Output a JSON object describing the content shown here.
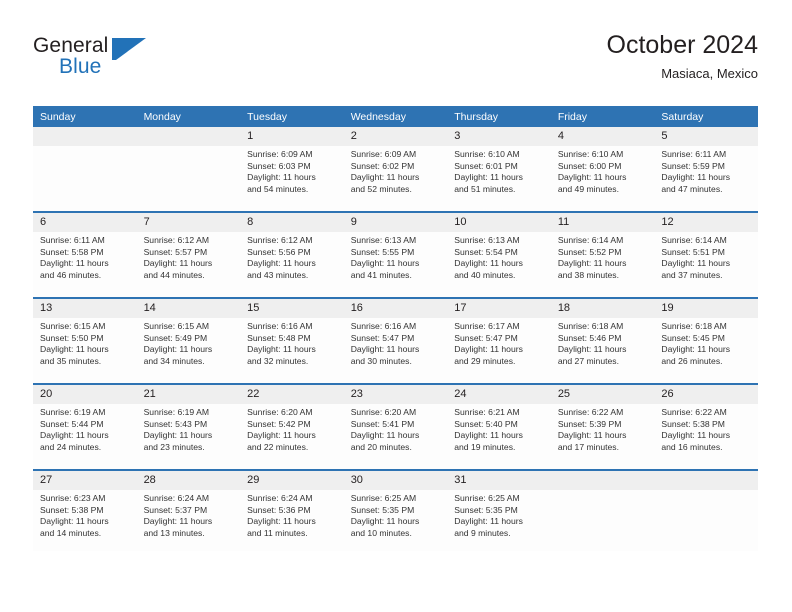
{
  "brand": {
    "name_top": "General",
    "name_bottom": "Blue",
    "logo_icon": "flag-triangle-icon",
    "accent_color": "#2272b8"
  },
  "header": {
    "title": "October 2024",
    "subtitle": "Masiaca, Mexico"
  },
  "theme": {
    "header_blue": "#2e73b3",
    "daynum_gray": "#efefef",
    "cell_white": "#fdfdfd"
  },
  "weekdays": [
    "Sunday",
    "Monday",
    "Tuesday",
    "Wednesday",
    "Thursday",
    "Friday",
    "Saturday"
  ],
  "weeks": [
    {
      "days": [
        {
          "num": "",
          "sunrise": "",
          "sunset": "",
          "daylight_1": "",
          "daylight_2": ""
        },
        {
          "num": "",
          "sunrise": "",
          "sunset": "",
          "daylight_1": "",
          "daylight_2": ""
        },
        {
          "num": "1",
          "sunrise": "Sunrise: 6:09 AM",
          "sunset": "Sunset: 6:03 PM",
          "daylight_1": "Daylight: 11 hours",
          "daylight_2": "and 54 minutes."
        },
        {
          "num": "2",
          "sunrise": "Sunrise: 6:09 AM",
          "sunset": "Sunset: 6:02 PM",
          "daylight_1": "Daylight: 11 hours",
          "daylight_2": "and 52 minutes."
        },
        {
          "num": "3",
          "sunrise": "Sunrise: 6:10 AM",
          "sunset": "Sunset: 6:01 PM",
          "daylight_1": "Daylight: 11 hours",
          "daylight_2": "and 51 minutes."
        },
        {
          "num": "4",
          "sunrise": "Sunrise: 6:10 AM",
          "sunset": "Sunset: 6:00 PM",
          "daylight_1": "Daylight: 11 hours",
          "daylight_2": "and 49 minutes."
        },
        {
          "num": "5",
          "sunrise": "Sunrise: 6:11 AM",
          "sunset": "Sunset: 5:59 PM",
          "daylight_1": "Daylight: 11 hours",
          "daylight_2": "and 47 minutes."
        }
      ]
    },
    {
      "days": [
        {
          "num": "6",
          "sunrise": "Sunrise: 6:11 AM",
          "sunset": "Sunset: 5:58 PM",
          "daylight_1": "Daylight: 11 hours",
          "daylight_2": "and 46 minutes."
        },
        {
          "num": "7",
          "sunrise": "Sunrise: 6:12 AM",
          "sunset": "Sunset: 5:57 PM",
          "daylight_1": "Daylight: 11 hours",
          "daylight_2": "and 44 minutes."
        },
        {
          "num": "8",
          "sunrise": "Sunrise: 6:12 AM",
          "sunset": "Sunset: 5:56 PM",
          "daylight_1": "Daylight: 11 hours",
          "daylight_2": "and 43 minutes."
        },
        {
          "num": "9",
          "sunrise": "Sunrise: 6:13 AM",
          "sunset": "Sunset: 5:55 PM",
          "daylight_1": "Daylight: 11 hours",
          "daylight_2": "and 41 minutes."
        },
        {
          "num": "10",
          "sunrise": "Sunrise: 6:13 AM",
          "sunset": "Sunset: 5:54 PM",
          "daylight_1": "Daylight: 11 hours",
          "daylight_2": "and 40 minutes."
        },
        {
          "num": "11",
          "sunrise": "Sunrise: 6:14 AM",
          "sunset": "Sunset: 5:52 PM",
          "daylight_1": "Daylight: 11 hours",
          "daylight_2": "and 38 minutes."
        },
        {
          "num": "12",
          "sunrise": "Sunrise: 6:14 AM",
          "sunset": "Sunset: 5:51 PM",
          "daylight_1": "Daylight: 11 hours",
          "daylight_2": "and 37 minutes."
        }
      ]
    },
    {
      "days": [
        {
          "num": "13",
          "sunrise": "Sunrise: 6:15 AM",
          "sunset": "Sunset: 5:50 PM",
          "daylight_1": "Daylight: 11 hours",
          "daylight_2": "and 35 minutes."
        },
        {
          "num": "14",
          "sunrise": "Sunrise: 6:15 AM",
          "sunset": "Sunset: 5:49 PM",
          "daylight_1": "Daylight: 11 hours",
          "daylight_2": "and 34 minutes."
        },
        {
          "num": "15",
          "sunrise": "Sunrise: 6:16 AM",
          "sunset": "Sunset: 5:48 PM",
          "daylight_1": "Daylight: 11 hours",
          "daylight_2": "and 32 minutes."
        },
        {
          "num": "16",
          "sunrise": "Sunrise: 6:16 AM",
          "sunset": "Sunset: 5:47 PM",
          "daylight_1": "Daylight: 11 hours",
          "daylight_2": "and 30 minutes."
        },
        {
          "num": "17",
          "sunrise": "Sunrise: 6:17 AM",
          "sunset": "Sunset: 5:47 PM",
          "daylight_1": "Daylight: 11 hours",
          "daylight_2": "and 29 minutes."
        },
        {
          "num": "18",
          "sunrise": "Sunrise: 6:18 AM",
          "sunset": "Sunset: 5:46 PM",
          "daylight_1": "Daylight: 11 hours",
          "daylight_2": "and 27 minutes."
        },
        {
          "num": "19",
          "sunrise": "Sunrise: 6:18 AM",
          "sunset": "Sunset: 5:45 PM",
          "daylight_1": "Daylight: 11 hours",
          "daylight_2": "and 26 minutes."
        }
      ]
    },
    {
      "days": [
        {
          "num": "20",
          "sunrise": "Sunrise: 6:19 AM",
          "sunset": "Sunset: 5:44 PM",
          "daylight_1": "Daylight: 11 hours",
          "daylight_2": "and 24 minutes."
        },
        {
          "num": "21",
          "sunrise": "Sunrise: 6:19 AM",
          "sunset": "Sunset: 5:43 PM",
          "daylight_1": "Daylight: 11 hours",
          "daylight_2": "and 23 minutes."
        },
        {
          "num": "22",
          "sunrise": "Sunrise: 6:20 AM",
          "sunset": "Sunset: 5:42 PM",
          "daylight_1": "Daylight: 11 hours",
          "daylight_2": "and 22 minutes."
        },
        {
          "num": "23",
          "sunrise": "Sunrise: 6:20 AM",
          "sunset": "Sunset: 5:41 PM",
          "daylight_1": "Daylight: 11 hours",
          "daylight_2": "and 20 minutes."
        },
        {
          "num": "24",
          "sunrise": "Sunrise: 6:21 AM",
          "sunset": "Sunset: 5:40 PM",
          "daylight_1": "Daylight: 11 hours",
          "daylight_2": "and 19 minutes."
        },
        {
          "num": "25",
          "sunrise": "Sunrise: 6:22 AM",
          "sunset": "Sunset: 5:39 PM",
          "daylight_1": "Daylight: 11 hours",
          "daylight_2": "and 17 minutes."
        },
        {
          "num": "26",
          "sunrise": "Sunrise: 6:22 AM",
          "sunset": "Sunset: 5:38 PM",
          "daylight_1": "Daylight: 11 hours",
          "daylight_2": "and 16 minutes."
        }
      ]
    },
    {
      "days": [
        {
          "num": "27",
          "sunrise": "Sunrise: 6:23 AM",
          "sunset": "Sunset: 5:38 PM",
          "daylight_1": "Daylight: 11 hours",
          "daylight_2": "and 14 minutes."
        },
        {
          "num": "28",
          "sunrise": "Sunrise: 6:24 AM",
          "sunset": "Sunset: 5:37 PM",
          "daylight_1": "Daylight: 11 hours",
          "daylight_2": "and 13 minutes."
        },
        {
          "num": "29",
          "sunrise": "Sunrise: 6:24 AM",
          "sunset": "Sunset: 5:36 PM",
          "daylight_1": "Daylight: 11 hours",
          "daylight_2": "and 11 minutes."
        },
        {
          "num": "30",
          "sunrise": "Sunrise: 6:25 AM",
          "sunset": "Sunset: 5:35 PM",
          "daylight_1": "Daylight: 11 hours",
          "daylight_2": "and 10 minutes."
        },
        {
          "num": "31",
          "sunrise": "Sunrise: 6:25 AM",
          "sunset": "Sunset: 5:35 PM",
          "daylight_1": "Daylight: 11 hours",
          "daylight_2": "and 9 minutes."
        },
        {
          "num": "",
          "sunrise": "",
          "sunset": "",
          "daylight_1": "",
          "daylight_2": ""
        },
        {
          "num": "",
          "sunrise": "",
          "sunset": "",
          "daylight_1": "",
          "daylight_2": ""
        }
      ]
    }
  ]
}
